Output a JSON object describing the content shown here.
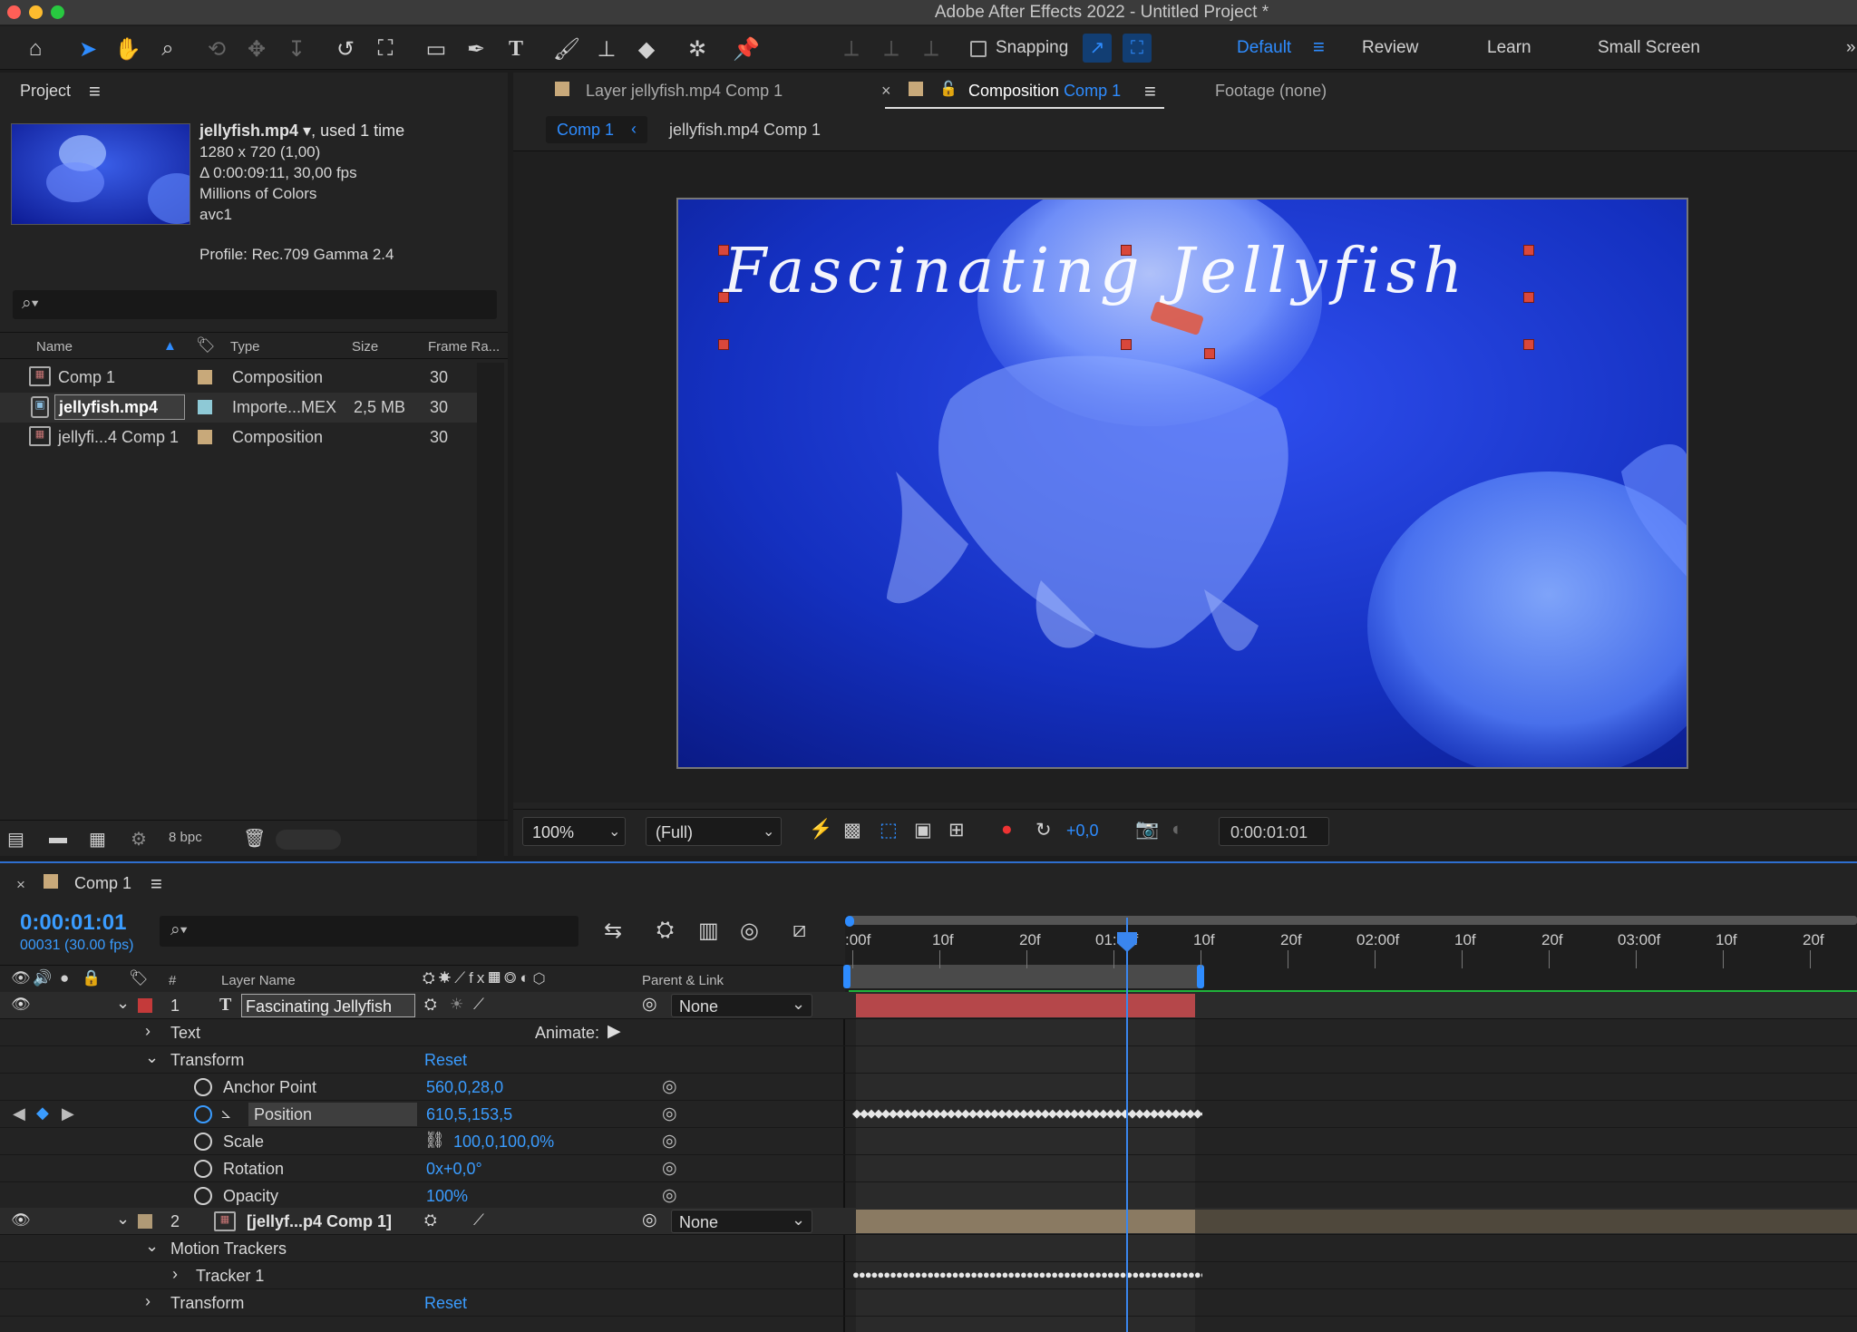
{
  "app": {
    "title": "Adobe After Effects 2022 - Untitled Project *"
  },
  "toolbar": {
    "snapping": "Snapping",
    "workspaces": [
      "Default",
      "Review",
      "Learn",
      "Small Screen"
    ]
  },
  "project": {
    "title": "Project",
    "file_name": "jellyfish.mp4",
    "used": ", used 1 time",
    "dimensions": "1280 x 720 (1,00)",
    "duration": "Δ 0:00:09:11, 30,00 fps",
    "colors": "Millions of Colors",
    "codec": "avc1",
    "profile": "Profile: Rec.709 Gamma 2.4",
    "columns": {
      "name": "Name",
      "type": "Type",
      "size": "Size",
      "frame_rate": "Frame Ra..."
    },
    "items": [
      {
        "name": "Comp 1",
        "type": "Composition",
        "size": "",
        "fps": "30",
        "label_color": "#c8a97a"
      },
      {
        "name": "jellyfish.mp4",
        "type": "Importe...MEX",
        "size": "2,5 MB",
        "fps": "30",
        "label_color": "#8ec9d6"
      },
      {
        "name": "jellyfi...4 Comp 1",
        "type": "Composition",
        "size": "",
        "fps": "30",
        "label_color": "#c8a97a"
      }
    ],
    "bpc": "8 bpc"
  },
  "viewer": {
    "tabs": {
      "layer": "Layer jellyfish.mp4 Comp 1",
      "composition_prefix": "Composition",
      "composition_name": "Comp 1",
      "footage": "Footage (none)"
    },
    "breadcrumbs": [
      "Comp 1",
      "jellyfish.mp4 Comp 1"
    ],
    "overlay_text": "Fascinating Jellyfish",
    "zoom": "100%",
    "resolution": "(Full)",
    "exposure": "+0,0",
    "timecode": "0:00:01:01"
  },
  "timeline": {
    "comp_name": "Comp 1",
    "current_time": "0:00:01:01",
    "frame_info": "00031 (30.00 fps)",
    "column_headers": {
      "num": "#",
      "layer_name": "Layer Name",
      "parent": "Parent & Link"
    },
    "ruler": [
      ":00f",
      "10f",
      "20f",
      "01:00f",
      "10f",
      "20f",
      "02:00f",
      "10f",
      "20f",
      "03:00f",
      "10f",
      "20f"
    ],
    "layers": [
      {
        "num": "1",
        "name": "Fascinating Jellyfish",
        "parent": "None",
        "color": "#c43a3a"
      },
      {
        "num": "2",
        "name": "[jellyf...p4 Comp 1]",
        "parent": "None",
        "color": "#b09a76"
      }
    ],
    "properties": {
      "text": "Text",
      "animate": "Animate:",
      "transform": "Transform",
      "reset": "Reset",
      "anchor_point": {
        "label": "Anchor Point",
        "value": "560,0,28,0"
      },
      "position": {
        "label": "Position",
        "value": "610,5,153,5"
      },
      "scale": {
        "label": "Scale",
        "value": "100,0,100,0%"
      },
      "rotation": {
        "label": "Rotation",
        "value": "0x+0,0°"
      },
      "opacity": {
        "label": "Opacity",
        "value": "100%"
      },
      "motion_trackers": "Motion Trackers",
      "tracker1": "Tracker 1",
      "transform2": "Transform",
      "reset2": "Reset"
    }
  }
}
